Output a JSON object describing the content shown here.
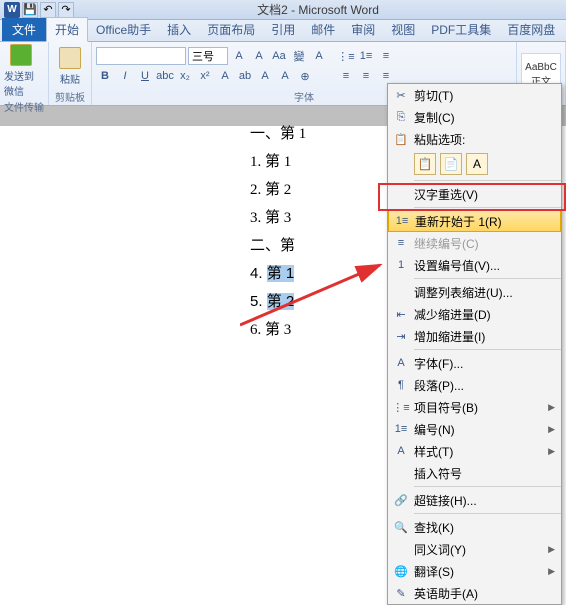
{
  "titlebar": {
    "title": "文档2 - Microsoft Word"
  },
  "tabs": {
    "file": "文件",
    "items": [
      "开始",
      "Office助手",
      "插入",
      "页面布局",
      "引用",
      "邮件",
      "审阅",
      "视图",
      "PDF工具集",
      "百度网盘"
    ],
    "active": 0
  },
  "ribbon": {
    "group1": {
      "send": "发送到微信",
      "paste": "粘贴",
      "label1": "文件传输",
      "label2": "剪贴板"
    },
    "font": {
      "name": "",
      "size": "三号",
      "label": "字体"
    },
    "styles": {
      "s1": "AaBbC",
      "s1n": "正文"
    }
  },
  "document": {
    "lines": [
      "一、第 1",
      "1. 第 1",
      "2. 第 2",
      "3. 第 3",
      "二、第",
      "第 1",
      "第 2",
      "6. 第 3"
    ],
    "sel_prefix_5": "4. ",
    "sel_prefix_6": "5. "
  },
  "context_menu": {
    "cut": "剪切(T)",
    "copy": "复制(C)",
    "paste_label": "粘贴选项:",
    "hanzi": "汉字重选(V)",
    "restart": "重新开始于 1(R)",
    "continue": "继续编号(C)",
    "set_num": "设置编号值(V)...",
    "adjust_indent": "调整列表缩进(U)...",
    "dec_indent": "减少缩进量(D)",
    "inc_indent": "增加缩进量(I)",
    "font": "字体(F)...",
    "para": "段落(P)...",
    "bullets": "项目符号(B)",
    "numbering": "编号(N)",
    "styles": "样式(T)",
    "insert_sym": "插入符号",
    "hyperlink": "超链接(H)...",
    "search": "查找(K)",
    "synonym": "同义词(Y)",
    "translate": "翻译(S)",
    "assistant": "英语助手(A)"
  }
}
